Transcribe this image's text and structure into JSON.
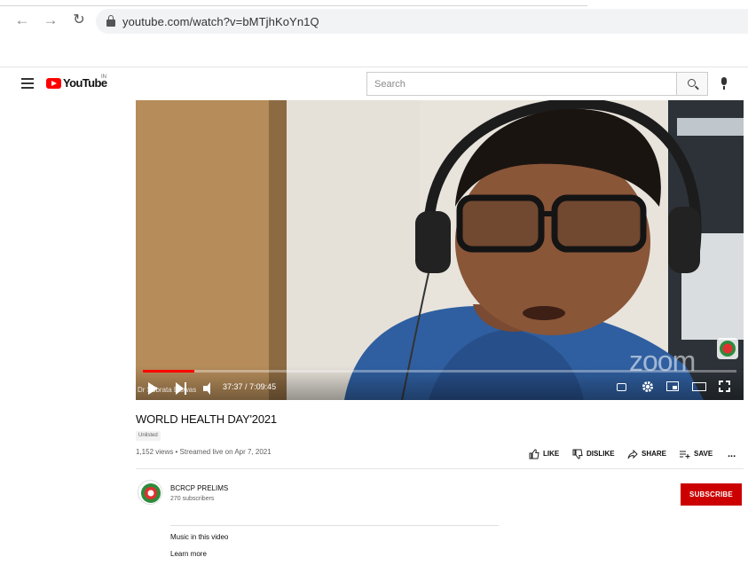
{
  "browser": {
    "url": "youtube.com/watch?v=bMTjhKoYn1Q",
    "icons": {
      "back": "arrow-left-icon",
      "forward": "arrow-right-icon",
      "reload": "reload-icon",
      "secure": "lock-icon"
    }
  },
  "masthead": {
    "logo_text": "YouTube",
    "country_code": "IN",
    "search_placeholder": "Search",
    "icons": {
      "menu": "hamburger-icon",
      "search": "search-icon",
      "voice": "microphone-icon"
    },
    "brand_color": "#ff0000"
  },
  "player": {
    "current_time": "37:37",
    "duration": "7:09:45",
    "progress_fraction": 0.087,
    "participant_name": "Dr Subrata Biswas",
    "watermark": "zoom",
    "progress_color": "#ff0000"
  },
  "video": {
    "title": "WORLD HEALTH DAY'2021",
    "badge": "Unlisted",
    "views": "1,152 views",
    "separator": "•",
    "streamed": "Streamed live on Apr 7, 2021",
    "actions": {
      "like": "LIKE",
      "dislike": "DISLIKE",
      "share": "SHARE",
      "save": "SAVE",
      "more": "..."
    }
  },
  "channel": {
    "name": "BCRCP PRELIMS",
    "subscribers": "270 subscribers",
    "subscribe_label": "SUBSCRIBE",
    "subscribe_color": "#cc0000"
  },
  "music": {
    "heading": "Music in this video",
    "learn_more": "Learn more"
  }
}
